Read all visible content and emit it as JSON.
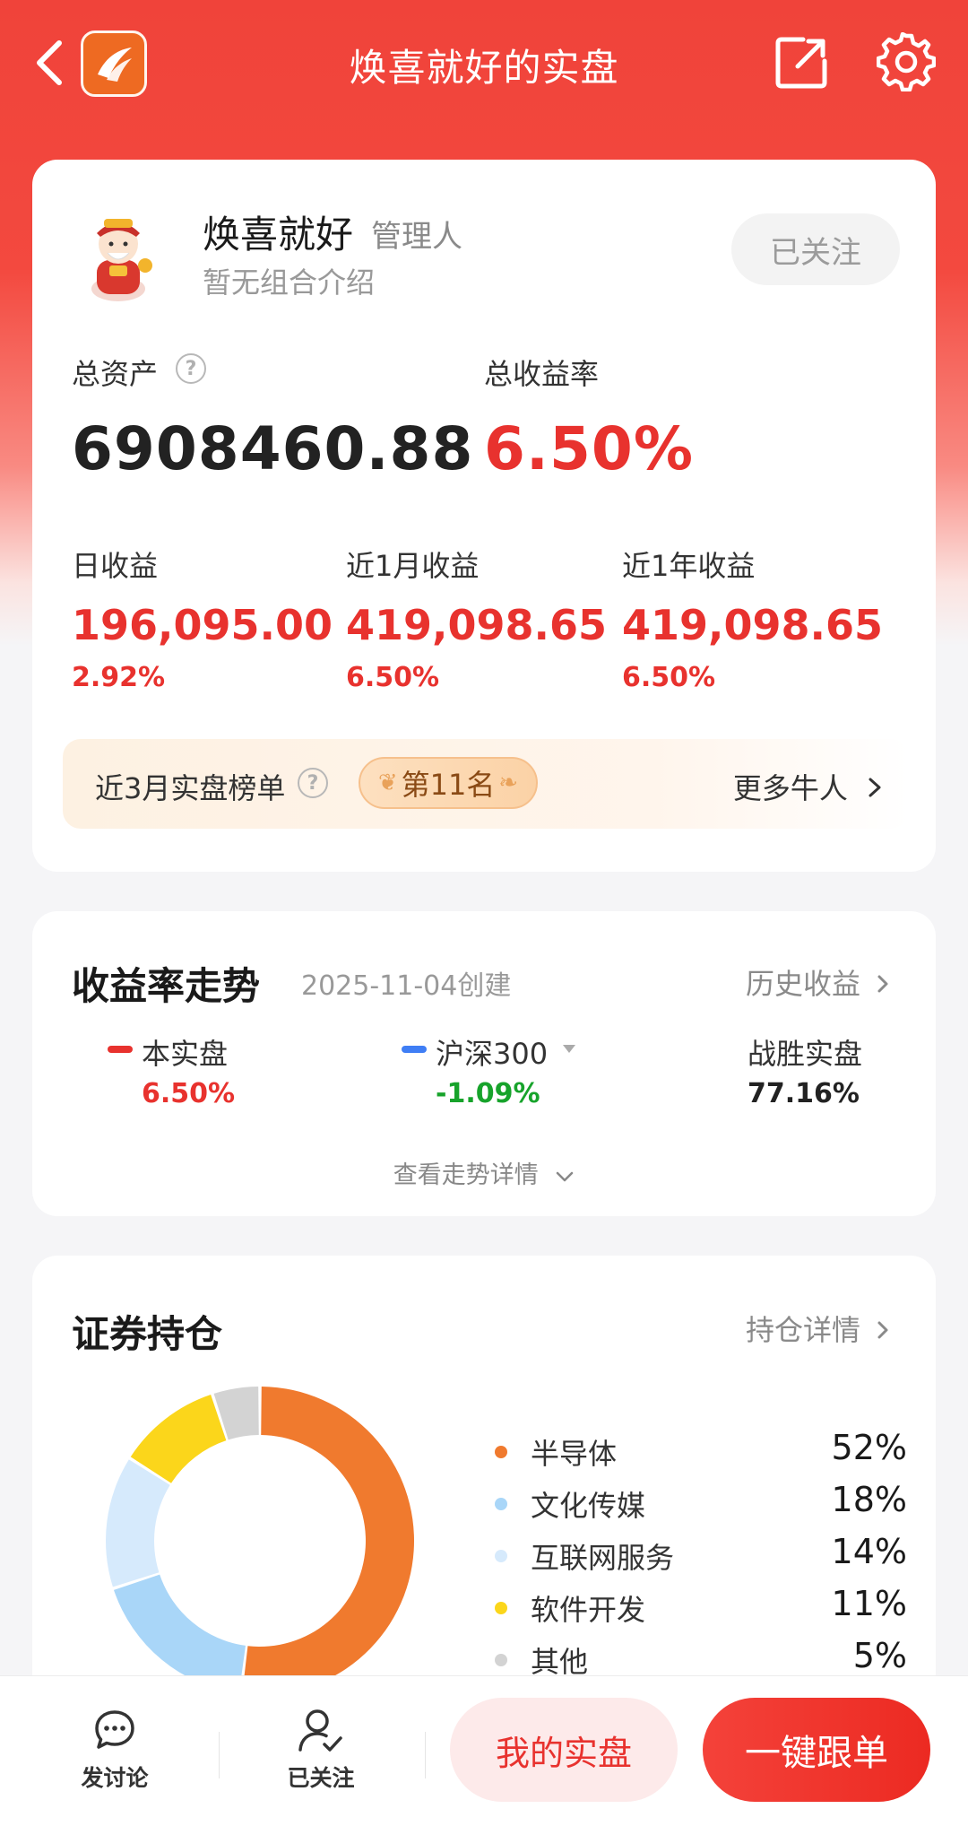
{
  "header": {
    "title": "焕喜就好的实盘",
    "icons": [
      "back-icon",
      "app-logo-icon",
      "share-icon",
      "gear-icon"
    ]
  },
  "profile": {
    "name": "焕喜就好",
    "role": "管理人",
    "description": "暂无组合介绍",
    "follow_label": "已关注"
  },
  "summary": {
    "total_assets_label": "总资产",
    "total_assets_value": "6908460.88",
    "total_return_label": "总收益率",
    "total_return_value": "6.50%",
    "stats": [
      {
        "label": "日收益",
        "value": "196,095.00",
        "pct": "2.92%"
      },
      {
        "label": "近1月收益",
        "value": "419,098.65",
        "pct": "6.50%"
      },
      {
        "label": "近1年收益",
        "value": "419,098.65",
        "pct": "6.50%"
      }
    ]
  },
  "ranking": {
    "label": "近3月实盘榜单",
    "rank": "第11名",
    "more_label": "更多牛人"
  },
  "trend": {
    "title": "收益率走势",
    "created": "2025-11-04创建",
    "history_link": "历史收益",
    "legend": [
      {
        "name": "本实盘",
        "value": "6.50%",
        "color": "#e8322e"
      },
      {
        "name": "沪深300",
        "value": "-1.09%",
        "color": "#3f7ef5"
      },
      {
        "name": "战胜实盘",
        "value": "77.16%"
      }
    ],
    "expand_label": "查看走势详情"
  },
  "holdings": {
    "title": "证券持仓",
    "detail_link": "持仓详情",
    "allocations": [
      {
        "name": "半导体",
        "pct": "52%",
        "share": 0.52,
        "color": "#f07a2e"
      },
      {
        "name": "文化传媒",
        "pct": "18%",
        "share": 0.18,
        "color": "#a9d6f8"
      },
      {
        "name": "互联网服务",
        "pct": "14%",
        "share": 0.14,
        "color": "#d6eafc"
      },
      {
        "name": "软件开发",
        "pct": "11%",
        "share": 0.11,
        "color": "#fbd61b"
      },
      {
        "name": "其他",
        "pct": "5%",
        "share": 0.05,
        "color": "#d3d3d3"
      }
    ]
  },
  "bottom_bar": {
    "discuss_label": "发讨论",
    "followed_label": "已关注",
    "my_portfolio_label": "我的实盘",
    "copy_trade_label": "一键跟单"
  }
}
